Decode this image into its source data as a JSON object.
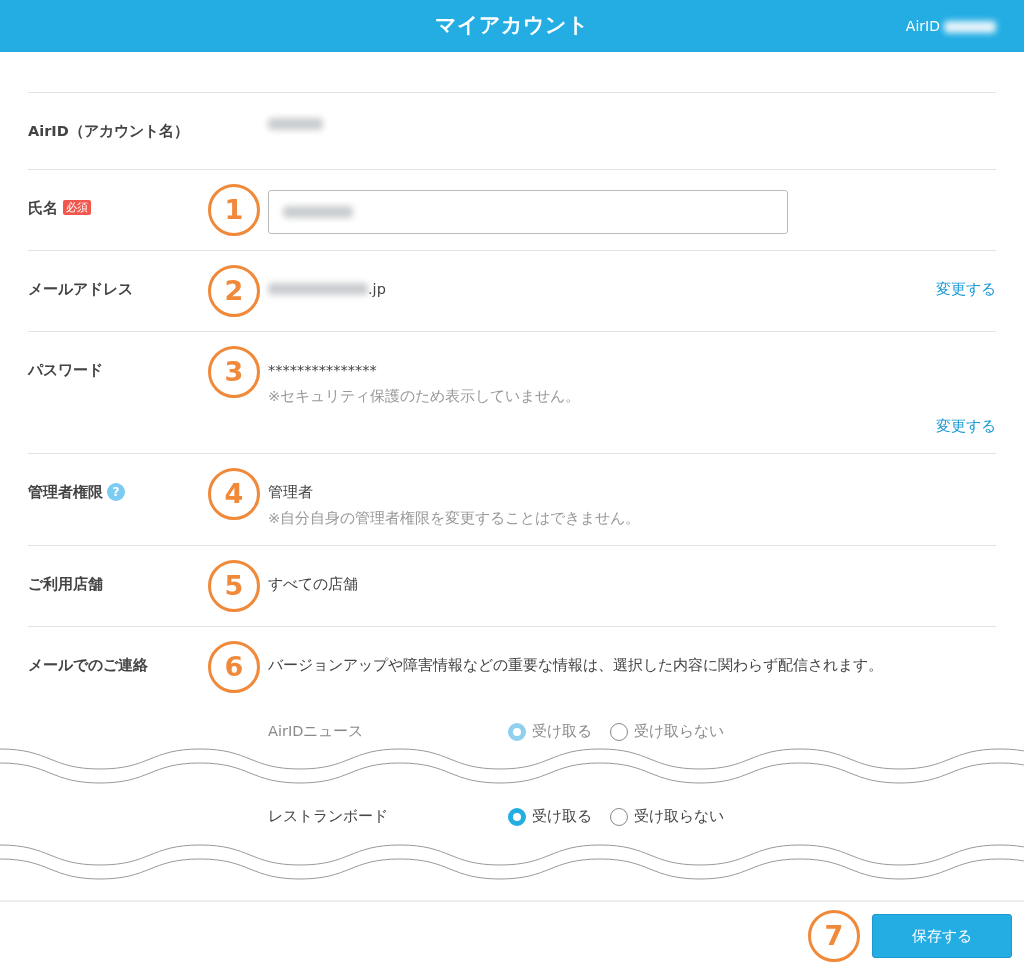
{
  "header": {
    "title": "マイアカウント",
    "account_label": "AirID",
    "account_redacted": true
  },
  "rows": [
    {
      "label": "AirID（アカウント名）",
      "kind": "text",
      "value_redacted": true
    },
    {
      "label": "氏名",
      "required_badge": "必須",
      "marker": "1",
      "kind": "input",
      "value_redacted": true
    },
    {
      "label": "メールアドレス",
      "marker": "2",
      "kind": "text",
      "value_redacted": true,
      "value": ".jp",
      "link": "変更する"
    },
    {
      "label": "パスワード",
      "marker": "3",
      "kind": "text",
      "value": "***************",
      "note": "※セキュリティ保護のため表示していません。",
      "link": "変更する"
    },
    {
      "label": "管理者権限",
      "help_icon": "?",
      "marker": "4",
      "kind": "text",
      "value": "管理者",
      "note": "※自分自身の管理者権限を変更することはできません。"
    },
    {
      "label": "ご利用店舗",
      "marker": "5",
      "kind": "text",
      "value": "すべての店舗"
    },
    {
      "label": "メールでのご連絡",
      "marker": "6",
      "kind": "text",
      "value": "バージョンアップや障害情報などの重要な情報は、選択した内容に関わらず配信されます。"
    }
  ],
  "subscriptions": [
    {
      "name": "AirIDニュース",
      "faded": true,
      "options": [
        {
          "label": "受け取る",
          "selected": true
        },
        {
          "label": "受け取らない",
          "selected": false
        }
      ]
    },
    {
      "name": "レストランボード",
      "faded": false,
      "options": [
        {
          "label": "受け取る",
          "selected": true
        },
        {
          "label": "受け取らない",
          "selected": false
        }
      ]
    }
  ],
  "footer": {
    "marker": "7",
    "save_button": "保存する"
  }
}
